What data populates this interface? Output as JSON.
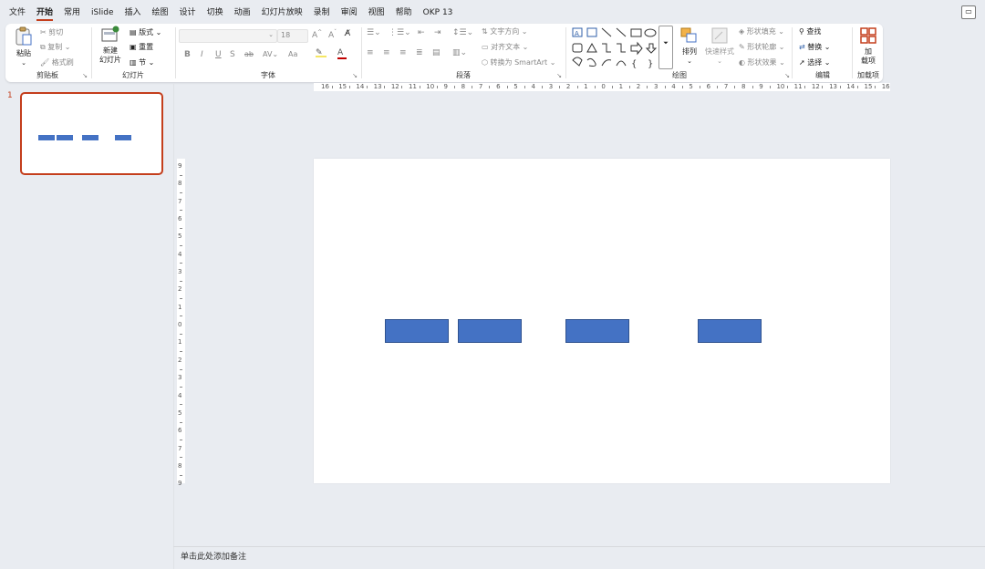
{
  "menu": {
    "tabs": [
      "文件",
      "开始",
      "常用",
      "iSlide",
      "插入",
      "绘图",
      "设计",
      "切换",
      "动画",
      "幻灯片放映",
      "录制",
      "审阅",
      "视图",
      "帮助",
      "OKP 13"
    ],
    "active_index": 1
  },
  "ribbon": {
    "clipboard": {
      "paste": "粘贴",
      "cut": "剪切",
      "copy": "复制",
      "format_painter": "格式刷",
      "group": "剪贴板"
    },
    "slides": {
      "new_slide_1": "新建",
      "new_slide_2": "幻灯片",
      "layout": "版式",
      "reset": "重置",
      "section": "节",
      "group": "幻灯片"
    },
    "font": {
      "font_size": "18",
      "group": "字体",
      "bold": "B",
      "italic": "I",
      "underline": "U",
      "shadow": "S",
      "strike": "ab",
      "change_case": "Aa",
      "font_color": "A",
      "grow": "A",
      "shrink": "A"
    },
    "paragraph": {
      "text_direction": "文字方向",
      "align_text": "对齐文本",
      "convert_smartart": "转换为 SmartArt",
      "group": "段落"
    },
    "drawing": {
      "arrange": "排列",
      "quick_styles_1": "快速样式",
      "shape_fill": "形状填充",
      "shape_outline": "形状轮廓",
      "shape_effects": "形状效果",
      "group": "绘图"
    },
    "editing": {
      "find": "查找",
      "replace": "替换",
      "select": "选择",
      "group": "编辑"
    },
    "addins": {
      "label_1": "加",
      "label_2": "载项",
      "group": "加载项"
    }
  },
  "thumbnails": [
    {
      "number": "1"
    }
  ],
  "ruler": {
    "horizontal": [
      "16",
      "15",
      "14",
      "13",
      "12",
      "11",
      "10",
      "9",
      "8",
      "7",
      "6",
      "5",
      "4",
      "3",
      "2",
      "1",
      "0",
      "1",
      "2",
      "3",
      "4",
      "5",
      "6",
      "7",
      "8",
      "9",
      "10",
      "11",
      "12",
      "13",
      "14",
      "15",
      "16"
    ],
    "vertical": [
      "9",
      "8",
      "7",
      "6",
      "5",
      "4",
      "3",
      "2",
      "1",
      "0",
      "1",
      "2",
      "3",
      "4",
      "5",
      "6",
      "7",
      "8",
      "9"
    ]
  },
  "slide": {
    "shape_color": "#4472c4",
    "shape_count": 4
  },
  "notes": {
    "placeholder": "单击此处添加备注"
  },
  "colors": {
    "accent": "#c43e1c",
    "shape_fill": "#4472c4",
    "background": "#e9ecf1"
  }
}
